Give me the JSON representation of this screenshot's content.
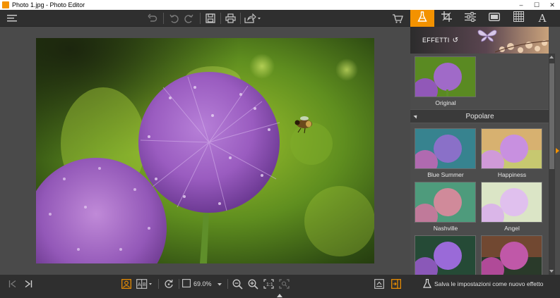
{
  "window": {
    "title": "Photo 1.jpg - Photo Editor",
    "minimize": "–",
    "maximize": "☐",
    "close": "✕"
  },
  "toolbar": {
    "icons": [
      "menu-icon",
      "undo-all-icon",
      "undo-icon",
      "redo-icon",
      "save-icon",
      "print-icon",
      "share-icon",
      "cart-icon"
    ]
  },
  "tabs": [
    {
      "name": "effects",
      "icon": "flask-icon",
      "active": true
    },
    {
      "name": "crop",
      "icon": "crop-icon",
      "active": false
    },
    {
      "name": "adjust",
      "icon": "sliders-icon",
      "active": false
    },
    {
      "name": "frame",
      "icon": "frame-icon",
      "active": false
    },
    {
      "name": "texture",
      "icon": "grid-icon",
      "active": false
    },
    {
      "name": "text",
      "icon": "text-icon",
      "label": "A",
      "active": false
    }
  ],
  "panel": {
    "effects_title": "EFFETTI",
    "original_label": "Original",
    "section_label": "Popolare",
    "effects": [
      {
        "label": "Blue Summer"
      },
      {
        "label": "Happiness"
      },
      {
        "label": "Nashville"
      },
      {
        "label": "Angel"
      },
      {
        "label": ""
      },
      {
        "label": ""
      }
    ]
  },
  "bottombar": {
    "zoom": "69.0%"
  },
  "save_bar": {
    "label": "Salva le impostazioni come nuovo effetto"
  },
  "colors": {
    "accent": "#f39200",
    "toolbar_bg": "#2f2f2f",
    "canvas_bg": "#4a4a4a"
  }
}
